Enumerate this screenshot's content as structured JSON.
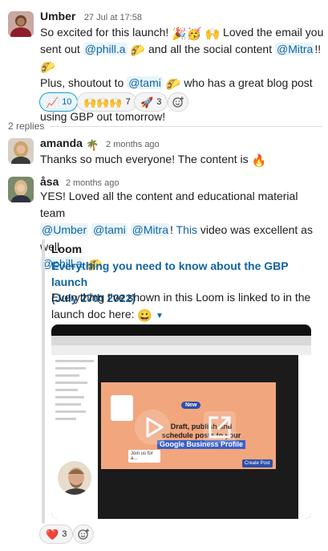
{
  "thread": {
    "parent": {
      "author": "Umber",
      "time": "27 Jul at 17:58",
      "line1": "So excited for this launch!",
      "line1b": "Loved the email you",
      "line2a": "sent out",
      "mention1": "@phill.a",
      "line2b": "and all the social content",
      "mention2": "@Mitra",
      "line2c": "!!",
      "line3a": "Plus, shoutout to",
      "mention3": "@tami",
      "line3b": "who has a great blog post about",
      "line4": "using GBP out tomorrow!",
      "reactions": [
        {
          "icon": "chart-emoji",
          "count": "10"
        },
        {
          "icon": "raised-hands-emoji",
          "count": "7"
        },
        {
          "icon": "rocket-emoji",
          "count": "3"
        }
      ]
    },
    "replies_label": "2 replies",
    "reply1": {
      "author": "amanda",
      "time": "2 months ago",
      "text": "Thanks so much everyone! The content is"
    },
    "reply2": {
      "author": "åsa",
      "time": "2 months ago",
      "line1": "YES! Loved all the content and educational material team",
      "mention1": "@Umber",
      "mention2": "@tami",
      "mention3": "@Mitra",
      "excl": "!",
      "link": "This",
      "line2b": "video was excellent as well",
      "mention4": "@phill.a",
      "attachment": {
        "source": "Loom",
        "title_line1": "Everything you need to know about the GBP launch",
        "title_line2": "(July 27th 2022)",
        "desc_line1": "Everything I've shown in this Loom is linked to in the",
        "desc_line2": "launch doc here:"
      },
      "video": {
        "badge": "New",
        "headline1": "Draft, publish and",
        "headline2": "schedule posts to your",
        "headline3": "Google Business Profile",
        "chip": "Join us for a...",
        "button": "Create Post"
      },
      "reactions": [
        {
          "icon": "heart-emoji",
          "count": "3"
        }
      ]
    }
  }
}
